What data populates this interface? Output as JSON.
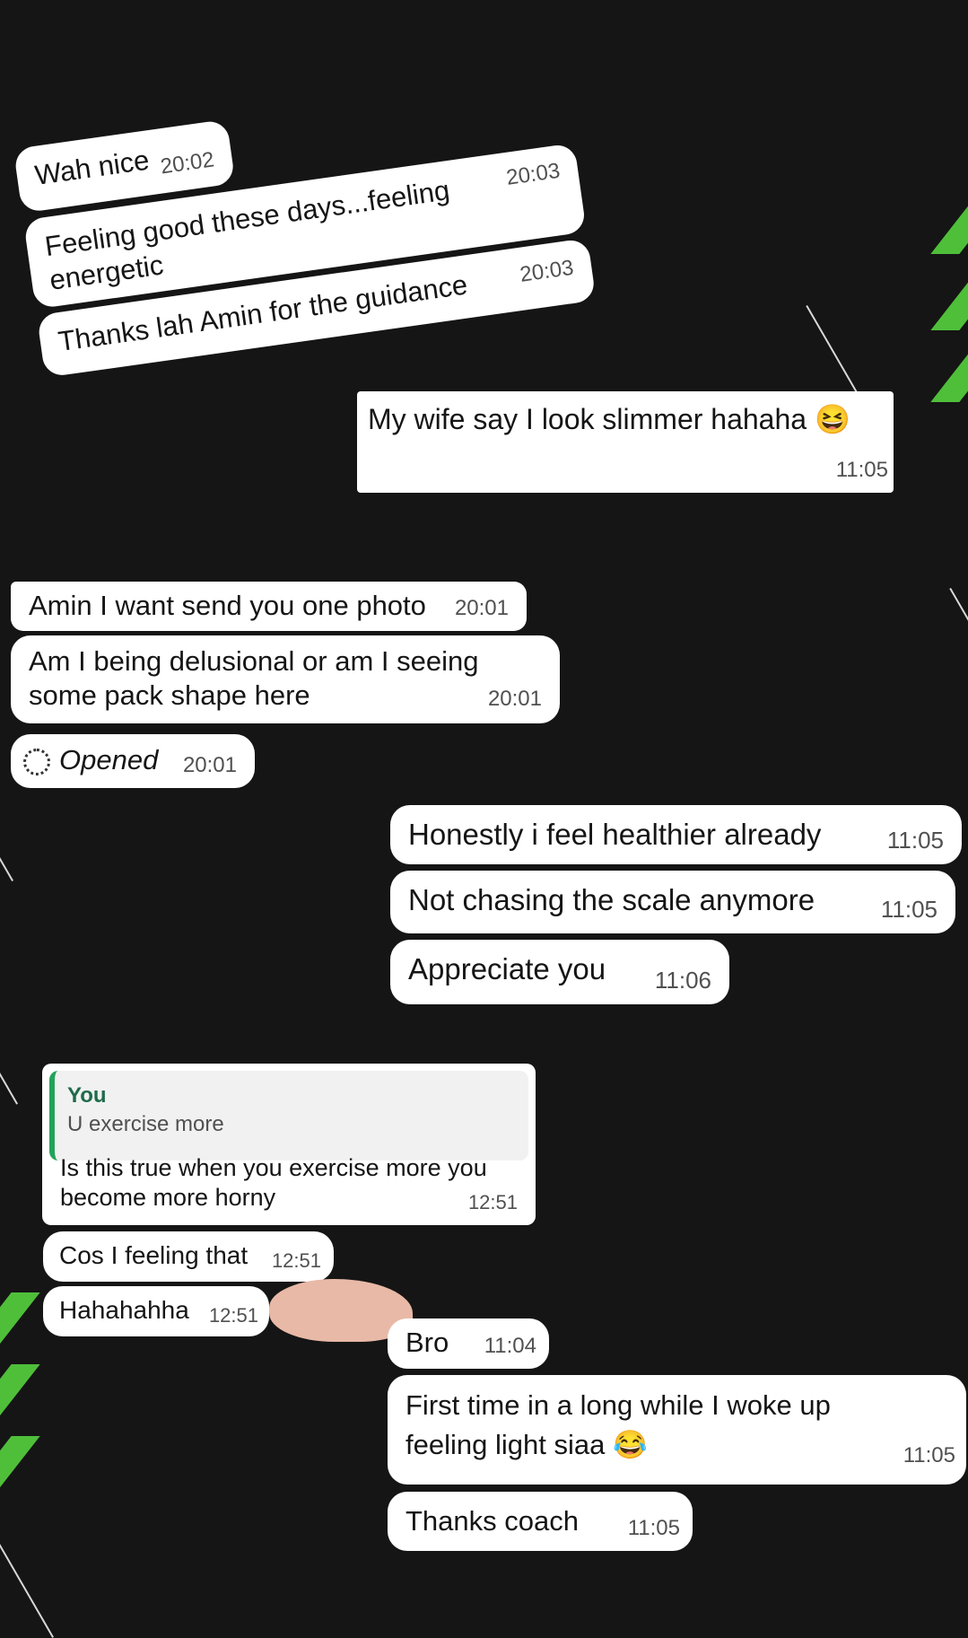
{
  "messages_top": [
    {
      "text": "Wah nice",
      "time": "20:02"
    },
    {
      "text_line1": "Feeling good these days...feeling",
      "text_line2": "energetic",
      "time": "20:03"
    },
    {
      "text": "Thanks lah Amin for the guidance",
      "time": "20:03"
    }
  ],
  "outgoing_1": {
    "text": "My wife say I look slimmer hahaha",
    "emoji": "😆",
    "time": "11:05"
  },
  "incoming_2": [
    {
      "text": "Amin I want send you one photo",
      "time": "20:01"
    },
    {
      "text_line1": "Am I being delusional or am I seeing",
      "text_line2": "some pack shape here",
      "time": "20:01"
    },
    {
      "text": "Opened",
      "time": "20:01"
    }
  ],
  "outgoing_2": [
    {
      "text": "Honestly i feel healthier already",
      "time": "11:05"
    },
    {
      "text": "Not chasing the scale anymore",
      "time": "11:05"
    },
    {
      "text": "Appreciate you",
      "time": "11:06"
    }
  ],
  "incoming_3": {
    "quote_author": "You",
    "quote_text": "U exercise more",
    "text_line1": "Is this true when you exercise more you",
    "text_line2": "become more horny",
    "time": "12:51",
    "followups": [
      {
        "text": "Cos I feeling that",
        "time": "12:51"
      },
      {
        "text": "Hahahahha",
        "time": "12:51"
      }
    ]
  },
  "outgoing_3": [
    {
      "text": "Bro",
      "time": "11:04"
    },
    {
      "text_line1": "First time in a long while I woke up",
      "text_line2": "feeling light siaa",
      "emoji": "😂",
      "time": "11:05"
    },
    {
      "text": "Thanks coach",
      "time": "11:05"
    }
  ],
  "colors": {
    "background": "#151515",
    "bubble": "#ffffff",
    "accent_green": "#4fbf3a",
    "quote_bar": "#23a35a"
  }
}
